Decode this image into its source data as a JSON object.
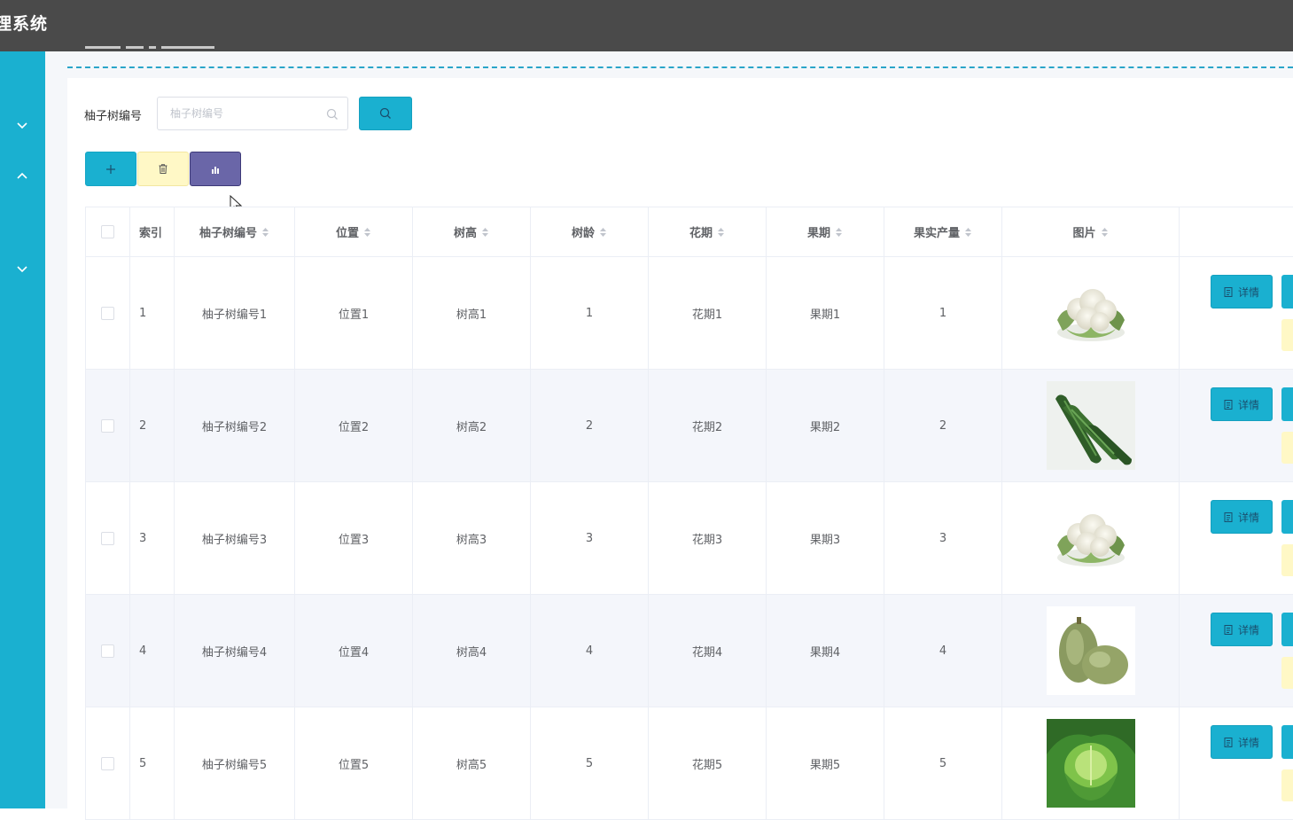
{
  "header": {
    "title": "理系统"
  },
  "search": {
    "label": "柚子树编号",
    "placeholder": "柚子树编号"
  },
  "table": {
    "columns": [
      "索引",
      "柚子树编号",
      "位置",
      "树高",
      "树龄",
      "花期",
      "果期",
      "果实产量",
      "图片"
    ],
    "detail_label": "详情",
    "rows": [
      {
        "index": "1",
        "code": "柚子树编号1",
        "location": "位置1",
        "height": "树高1",
        "age": "1",
        "flower": "花期1",
        "fruit": "果期1",
        "yield": "1",
        "image": "cauliflower"
      },
      {
        "index": "2",
        "code": "柚子树编号2",
        "location": "位置2",
        "height": "树高2",
        "age": "2",
        "flower": "花期2",
        "fruit": "果期2",
        "yield": "2",
        "image": "cucumber"
      },
      {
        "index": "3",
        "code": "柚子树编号3",
        "location": "位置3",
        "height": "树高3",
        "age": "3",
        "flower": "花期3",
        "fruit": "果期3",
        "yield": "3",
        "image": "cauliflower"
      },
      {
        "index": "4",
        "code": "柚子树编号4",
        "location": "位置4",
        "height": "树高4",
        "age": "4",
        "flower": "花期4",
        "fruit": "果期4",
        "yield": "4",
        "image": "wax-gourd"
      },
      {
        "index": "5",
        "code": "柚子树编号5",
        "location": "位置5",
        "height": "树高5",
        "age": "5",
        "flower": "花期5",
        "fruit": "果期5",
        "yield": "5",
        "image": "cabbage"
      }
    ]
  },
  "icons": {
    "sidebar": [
      "chevron-down-icon",
      "chevron-up-icon",
      "chevron-down-icon"
    ],
    "search_input": "search-icon",
    "search_button": "search-icon",
    "add_button": "plus-icon",
    "delete_button": "trash-icon",
    "stats_button": "bar-chart-icon",
    "detail_button": "document-icon",
    "sort": "sort-icon"
  },
  "colors": {
    "accent": "#1ab0d0",
    "topbar": "#4a4a4a",
    "delete_button": "#fff8c6",
    "stats_button": "#6a66a8"
  }
}
